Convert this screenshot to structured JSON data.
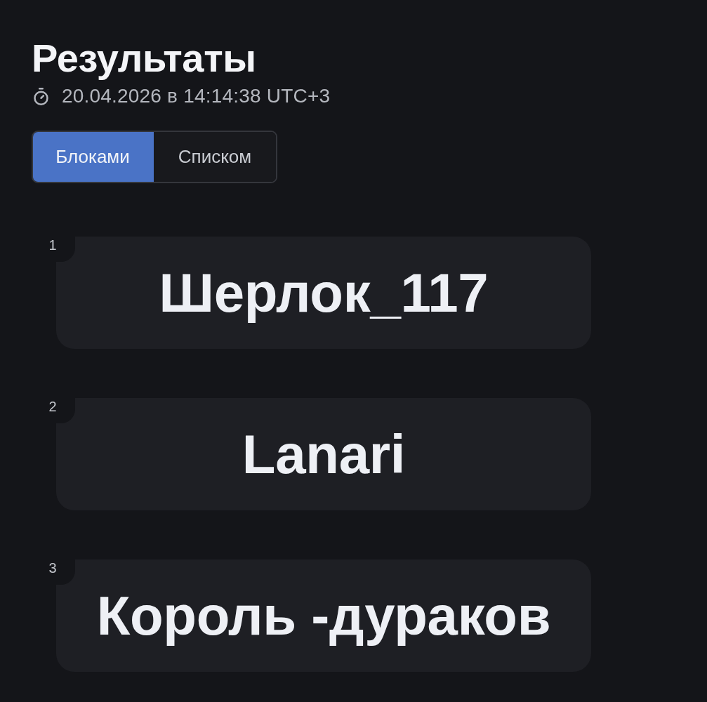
{
  "title": "Результаты",
  "timestamp": "20.04.2026 в 14:14:38 UTC+3",
  "view_toggle": [
    {
      "label": "Блоками",
      "selected": true
    },
    {
      "label": "Списком",
      "selected": false
    }
  ],
  "results": [
    {
      "rank": "1",
      "name": "Шерлок_117"
    },
    {
      "rank": "2",
      "name": "Lanari"
    },
    {
      "rank": "3",
      "name": "Король -дураков"
    }
  ]
}
